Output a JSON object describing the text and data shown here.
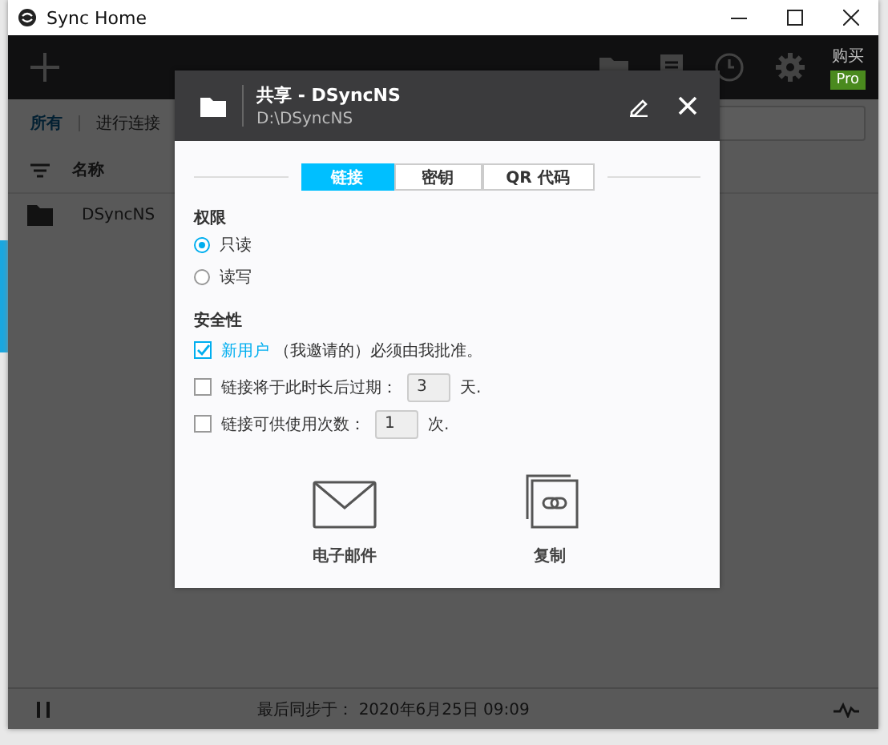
{
  "window": {
    "title": "Sync Home"
  },
  "toolbar": {
    "purchase_label": "购买",
    "pro_badge": "Pro"
  },
  "filter_tabs": [
    {
      "label": "所有",
      "selected": true
    },
    {
      "label": "进行连接",
      "selected": false
    }
  ],
  "list": {
    "column_header": "名称",
    "rows": [
      {
        "name": "DSyncNS"
      }
    ]
  },
  "status_bar": {
    "text": "最后同步于： 2020年6月25日 09:09"
  },
  "dialog": {
    "title": "共享 - DSyncNS",
    "path": "D:\\DSyncNS",
    "tabs": [
      {
        "label": "链接",
        "selected": true
      },
      {
        "label": "密钥",
        "selected": false
      },
      {
        "label": "QR 代码",
        "selected": false
      }
    ],
    "permissions_heading": "权限",
    "permissions": [
      {
        "label": "只读",
        "selected": true
      },
      {
        "label": "读写",
        "selected": false
      }
    ],
    "security_heading": "安全性",
    "security_options": [
      {
        "kind": "text",
        "link_text": "新用户",
        "text": "（我邀请的）必须由我批准。",
        "checked": true
      },
      {
        "kind": "field",
        "text": "链接将于此时长后过期：",
        "value": "3",
        "unit": "天.",
        "checked": false
      },
      {
        "kind": "field",
        "text": "链接可供使用次数：",
        "value": "1",
        "unit": "次.",
        "checked": false
      }
    ],
    "actions": [
      {
        "kind": "email",
        "label": "电子邮件"
      },
      {
        "kind": "copy",
        "label": "复制"
      }
    ]
  }
}
